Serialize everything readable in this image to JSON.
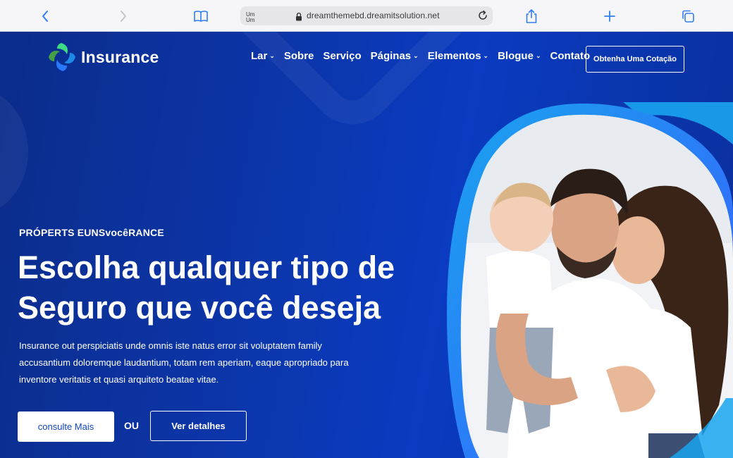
{
  "browser": {
    "reader_label": "Um Um",
    "url": "dreamthemebd.dreamitsolution.net",
    "icons": [
      "back-icon",
      "forward-icon",
      "bookmarks-icon",
      "lock-icon",
      "reload-icon",
      "share-icon",
      "new-tab-icon",
      "tabs-icon"
    ]
  },
  "site": {
    "logo_text": "Insurance",
    "nav": [
      {
        "label": "Lar",
        "dropdown": true
      },
      {
        "label": "Sobre",
        "dropdown": false
      },
      {
        "label": "Serviço",
        "dropdown": false
      },
      {
        "label": "Páginas",
        "dropdown": true
      },
      {
        "label": "Elementos",
        "dropdown": true
      },
      {
        "label": "Blogue",
        "dropdown": true
      },
      {
        "label": "Contato",
        "dropdown": false
      }
    ],
    "cta_label": "Obtenha Uma Cotação"
  },
  "hero": {
    "kicker": "PRÓPERTS EUNSvocêRANCE",
    "headline_line1": "Escolha qualquer tipo de",
    "headline_line2": "Seguro que você deseja",
    "description": "Insurance out perspiciatis unde omnis iste natus error sit voluptatem family accusantium doloremque laudantium, totam rem aperiam, eaque apropriado para inventore veritatis et quasi arquiteto beatae vitae.",
    "primary_button": "consulte Mais",
    "or_text": "OU",
    "secondary_button": "Ver detalhes"
  },
  "colors": {
    "hero_bg": "#0c35a8",
    "accent_cyan": "#19a3ee",
    "button_text": "#1346c4"
  }
}
